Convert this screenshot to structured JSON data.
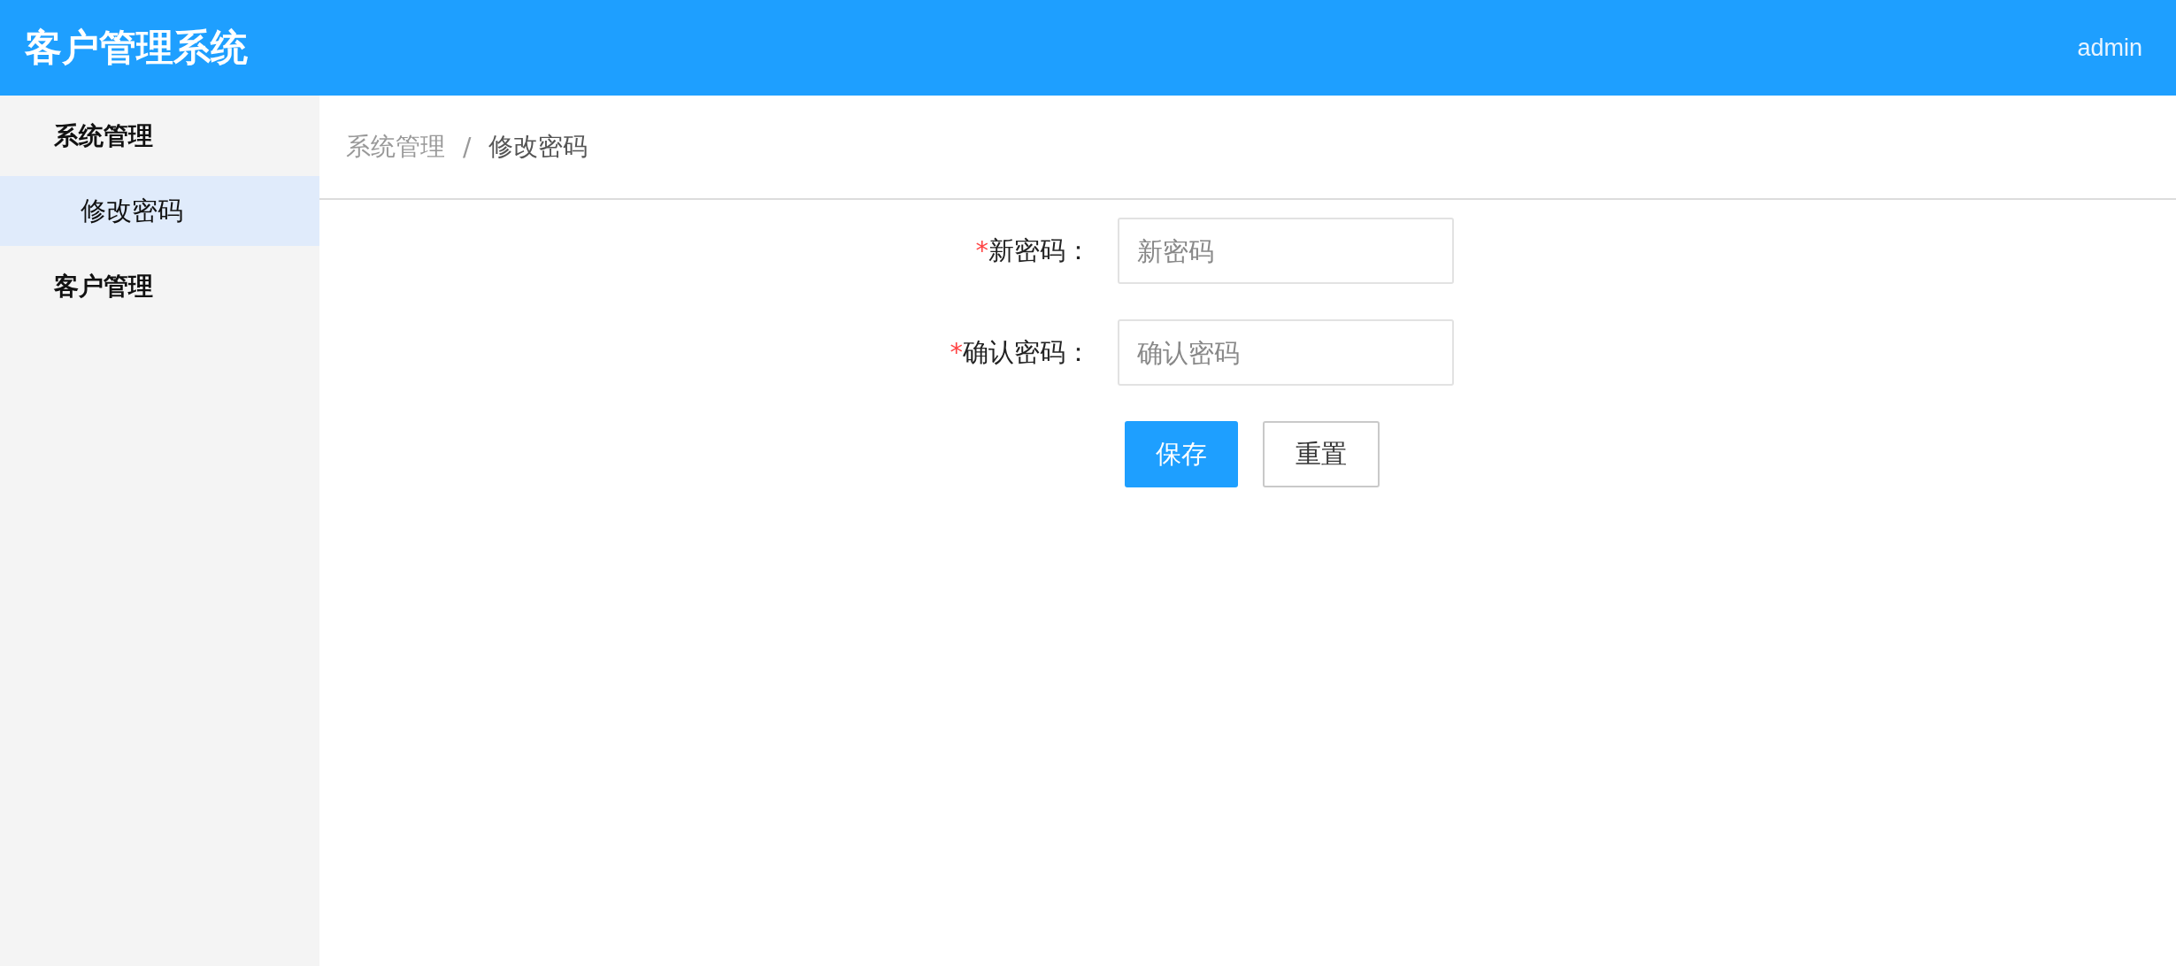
{
  "header": {
    "title": "客户管理系统",
    "user": "admin"
  },
  "sidebar": {
    "items": [
      {
        "label": "系统管理",
        "children": [
          {
            "label": "修改密码",
            "selected": true
          }
        ]
      },
      {
        "label": "客户管理"
      }
    ]
  },
  "breadcrumb": {
    "items": [
      "系统管理",
      "修改密码"
    ],
    "separator": "/"
  },
  "form": {
    "fields": [
      {
        "label": "新密码：",
        "required_mark": "*",
        "placeholder": "新密码"
      },
      {
        "label": "确认密码：",
        "required_mark": "*",
        "placeholder": "确认密码"
      }
    ],
    "buttons": [
      {
        "label": "保存",
        "kind": "primary"
      },
      {
        "label": "重置",
        "kind": "default"
      }
    ]
  }
}
